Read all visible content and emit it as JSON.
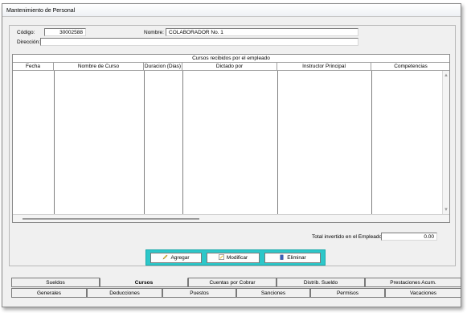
{
  "window": {
    "title": "Mantenimiento de Personal"
  },
  "form": {
    "codigo_label": "Código:",
    "codigo_value": "30002588",
    "nombre_label": "Nombre:",
    "nombre_value": "COLABORADOR No. 1",
    "direccion_label": "Dirección:",
    "direccion_value": ""
  },
  "grid": {
    "caption": "Cursos recibidos por el empleado",
    "columns": [
      "Fecha",
      "Nombre de Curso",
      "Duracion (Dias)",
      "Dictado por",
      "Instructor Principal",
      "Competencias"
    ],
    "rows": []
  },
  "total": {
    "label": "Total invertido en el Empleado:",
    "value": "0.00"
  },
  "actions": {
    "add": "Agregar",
    "edit": "Modificar",
    "delete": "Eliminar"
  },
  "tabs_top": [
    "Sueldos",
    "Cursos",
    "Cuentas por Cobrar",
    "Distrib. Sueldo",
    "Prestaciones Acum."
  ],
  "tabs_top_active": "Cursos",
  "tabs_bottom": [
    "Generales",
    "Deducciones",
    "Puestos",
    "Sanciones",
    "Permisos",
    "Vacaciones"
  ],
  "colors": {
    "button_bar": "#2dc7c9",
    "edit_icon": "#e8c238",
    "delete_icon": "#3b5fb8"
  }
}
